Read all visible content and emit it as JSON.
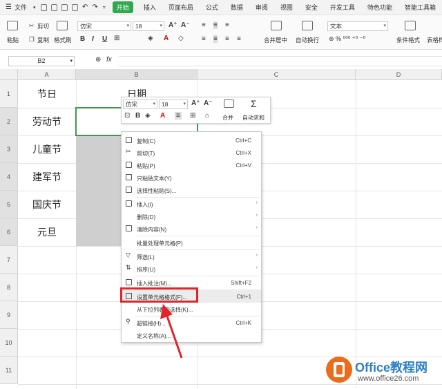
{
  "menubar": {
    "file": "文件",
    "tabs": [
      "开始",
      "插入",
      "页面布局",
      "公式",
      "数据",
      "审阅",
      "视图",
      "安全",
      "开发工具",
      "特色功能",
      "智能工具箱"
    ]
  },
  "ribbon": {
    "cut": "剪切",
    "paste": "粘贴",
    "copy": "复制",
    "format_painter": "格式刷",
    "font": "仿宋",
    "size": "18",
    "merge": "合并居中",
    "wrap": "自动换行",
    "number_format": "文本",
    "cond_format": "条件格式",
    "table_style": "表格样"
  },
  "formula_bar": {
    "name_box": "B2",
    "fx": "fx"
  },
  "columns": [
    "A",
    "B",
    "C",
    "D"
  ],
  "rows": [
    "1",
    "2",
    "3",
    "4",
    "5",
    "6",
    "7",
    "8",
    "9",
    "10",
    "11"
  ],
  "cells_a": [
    "节日",
    "劳动节",
    "儿童节",
    "建军节",
    "国庆节",
    "元旦"
  ],
  "cell_b1": "日期",
  "mini_toolbar": {
    "font": "仿宋",
    "size": "18",
    "merge": "合并",
    "autosum": "自动求和"
  },
  "context_menu": [
    {
      "label": "复制(C)",
      "shortcut": "Ctrl+C"
    },
    {
      "label": "剪切(T)",
      "shortcut": "Ctrl+X"
    },
    {
      "label": "粘贴(P)",
      "shortcut": "Ctrl+V"
    },
    {
      "label": "只粘贴文本(Y)",
      "shortcut": ""
    },
    {
      "label": "选择性粘贴(S)...",
      "shortcut": ""
    },
    {
      "label": "插入(I)",
      "shortcut": ""
    },
    {
      "label": "删除(D)",
      "shortcut": ""
    },
    {
      "label": "清除内容(N)",
      "shortcut": ""
    },
    {
      "label": "批量处理单元格(P)",
      "shortcut": ""
    },
    {
      "label": "筛选(L)",
      "shortcut": ""
    },
    {
      "label": "排序(U)",
      "shortcut": ""
    },
    {
      "label": "插入批注(M)...",
      "shortcut": "Shift+F2"
    },
    {
      "label": "设置单元格格式(F)...",
      "shortcut": "Ctrl+1"
    },
    {
      "label": "从下拉列表中选择(K)...",
      "shortcut": ""
    },
    {
      "label": "超链接(H)...",
      "shortcut": "Ctrl+K"
    },
    {
      "label": "定义名称(A)...",
      "shortcut": ""
    }
  ],
  "watermark": {
    "brand": "Office教程网",
    "url": "www.office26.com"
  }
}
